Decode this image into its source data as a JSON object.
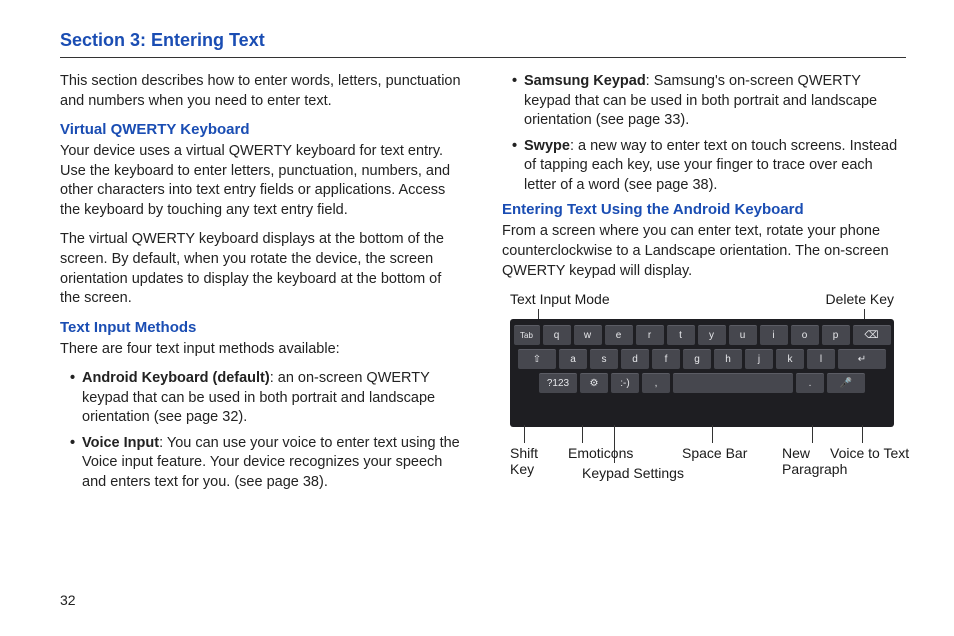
{
  "section_title": "Section 3: Entering Text",
  "page_number": "32",
  "left": {
    "intro": "This section describes how to enter words, letters, punctuation and numbers when you need to enter text.",
    "h1": "Virtual QWERTY Keyboard",
    "p1": "Your device uses a virtual QWERTY keyboard for text entry. Use the keyboard to enter letters, punctuation, numbers, and other characters into text entry fields or applications. Access the keyboard by touching any text entry field.",
    "p2": "The virtual QWERTY keyboard displays at the bottom of the screen. By default, when you rotate the device, the screen orientation updates to display the keyboard at the bottom of the screen.",
    "h2": "Text Input Methods",
    "p3": "There are four text input methods available:",
    "b1_bold": "Android Keyboard (default)",
    "b1_rest": ": an on-screen QWERTY keypad that can be used in both portrait and landscape orientation (see page 32).",
    "b2_bold": "Voice Input",
    "b2_rest": ": You can use your voice to enter text using the Voice input feature. Your device recognizes your speech and enters text for you. (see page 38)."
  },
  "right": {
    "b3_bold": "Samsung Keypad",
    "b3_rest": ": Samsung's on-screen QWERTY keypad that can be used in both portrait and landscape orientation (see page 33).",
    "b4_bold": "Swype",
    "b4_rest": ": a new way to enter text on touch screens. Instead of tapping each key, use your finger to trace over each letter of a word (see page 38).",
    "h3": "Entering Text Using the Android Keyboard",
    "p4": "From a screen where you can enter text, rotate your phone counterclockwise to a Landscape orientation. The on-screen QWERTY keypad will display."
  },
  "labels": {
    "text_input_mode": "Text Input Mode",
    "delete_key": "Delete Key",
    "shift_key": "Shift",
    "shift_key2": "Key",
    "emoticons": "Emoticons",
    "space_bar": "Space Bar",
    "new_para": "New",
    "new_para2": "Paragraph",
    "voice_text": "Voice to Text",
    "keypad_settings": "Keypad Settings"
  },
  "keys": {
    "row1": [
      "Tab",
      "q",
      "w",
      "e",
      "r",
      "t",
      "y",
      "u",
      "i",
      "o",
      "p",
      "⌫"
    ],
    "row2": [
      "⇧",
      "a",
      "s",
      "d",
      "f",
      "g",
      "h",
      "j",
      "k",
      "l",
      "↵"
    ],
    "row3": [
      "?123",
      "⚙",
      ":-)",
      ",",
      "",
      "",
      ".",
      "🎤"
    ]
  }
}
